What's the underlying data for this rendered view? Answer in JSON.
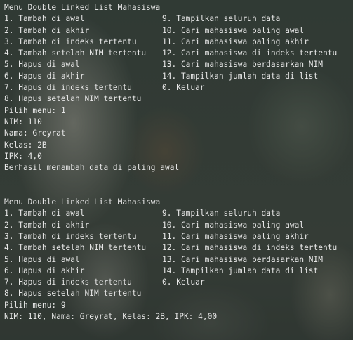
{
  "session1": {
    "menu_title": "Menu Double Linked List Mahasiswa",
    "left_options": [
      "1. Tambah di awal",
      "2. Tambah di akhir",
      "3. Tambah di indeks tertentu",
      "4. Tambah setelah NIM tertentu",
      "5. Hapus di awal",
      "6. Hapus di akhir",
      "7. Hapus di indeks tertentu",
      "8. Hapus setelah NIM tertentu"
    ],
    "right_options": [
      "9. Tampilkan seluruh data",
      "10. Cari mahasiswa paling awal",
      "11. Cari mahasiswa paling akhir",
      "12. Cari mahasiswa di indeks tertentu",
      "13. Cari mahasiswa berdasarkan NIM",
      "14. Tampilkan jumlah data di list",
      "0. Keluar"
    ],
    "output": [
      "Pilih menu: 1",
      "NIM: 110",
      "Nama: Greyrat",
      "Kelas: 2B",
      "IPK: 4,0",
      "Berhasil menambah data di paling awal"
    ]
  },
  "session2": {
    "menu_title": "Menu Double Linked List Mahasiswa",
    "left_options": [
      "1. Tambah di awal",
      "2. Tambah di akhir",
      "3. Tambah di indeks tertentu",
      "4. Tambah setelah NIM tertentu",
      "5. Hapus di awal",
      "6. Hapus di akhir",
      "7. Hapus di indeks tertentu",
      "8. Hapus setelah NIM tertentu"
    ],
    "right_options": [
      "9. Tampilkan seluruh data",
      "10. Cari mahasiswa paling awal",
      "11. Cari mahasiswa paling akhir",
      "12. Cari mahasiswa di indeks tertentu",
      "13. Cari mahasiswa berdasarkan NIM",
      "14. Tampilkan jumlah data di list",
      "0. Keluar"
    ],
    "output": [
      "Pilih menu: 9",
      "NIM: 110, Nama: Greyrat, Kelas: 2B, IPK: 4,00"
    ]
  },
  "colors": {
    "text": "#e6e6e6",
    "background": "#3f4941"
  }
}
